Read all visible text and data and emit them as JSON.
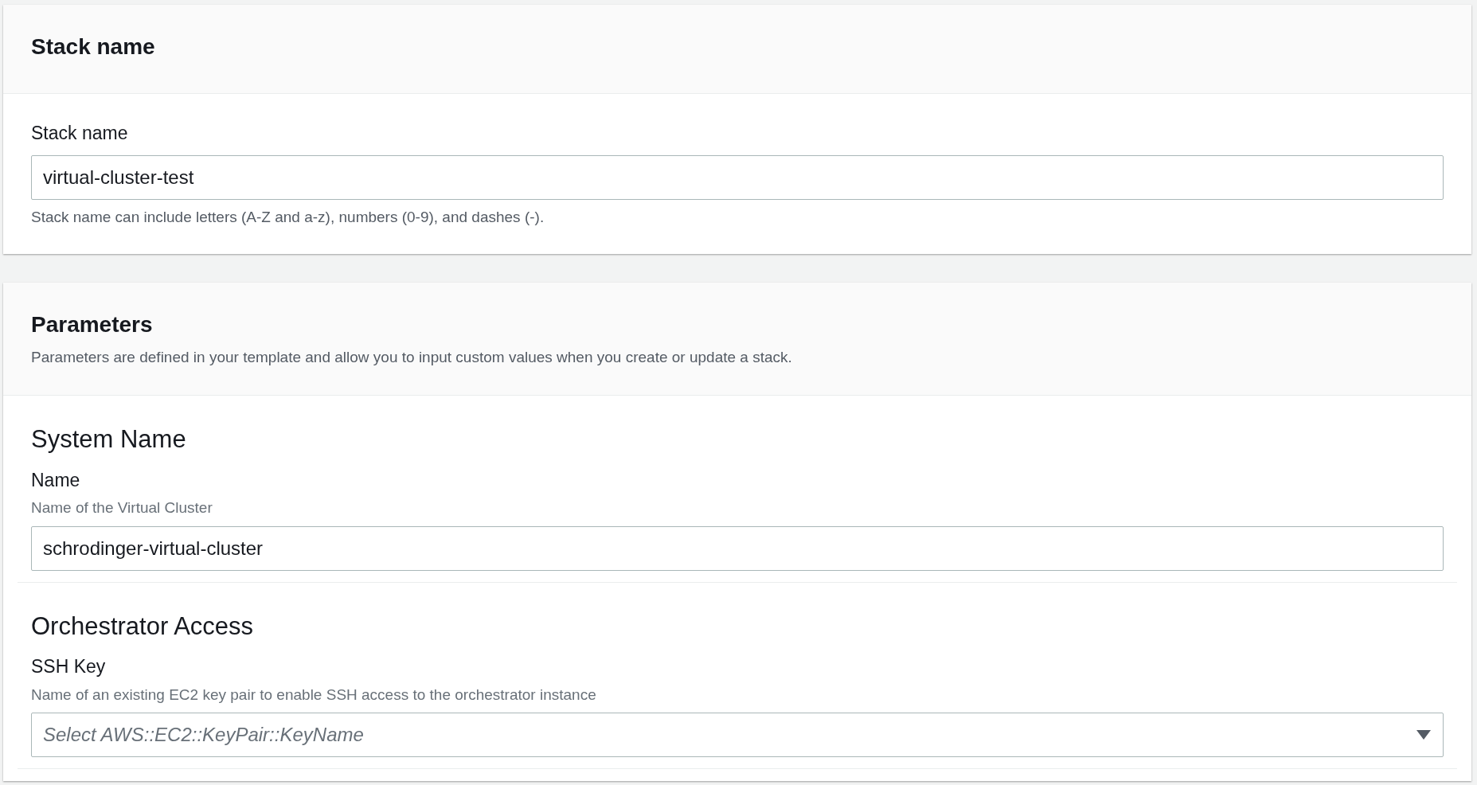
{
  "stack_section": {
    "title": "Stack name",
    "field": {
      "label": "Stack name",
      "value": "virtual-cluster-test",
      "hint": "Stack name can include letters (A-Z and a-z), numbers (0-9), and dashes (-)."
    }
  },
  "parameters_section": {
    "title": "Parameters",
    "description": "Parameters are defined in your template and allow you to input custom values when you create or update a stack.",
    "groups": [
      {
        "heading": "System Name",
        "field": {
          "kind": "text",
          "label": "Name",
          "description": "Name of the Virtual Cluster",
          "value": "schrodinger-virtual-cluster"
        }
      },
      {
        "heading": "Orchestrator Access",
        "field": {
          "kind": "select",
          "label": "SSH Key",
          "description": "Name of an existing EC2 key pair to enable SSH access to the orchestrator instance",
          "placeholder": "Select AWS::EC2::KeyPair::KeyName"
        }
      }
    ]
  }
}
